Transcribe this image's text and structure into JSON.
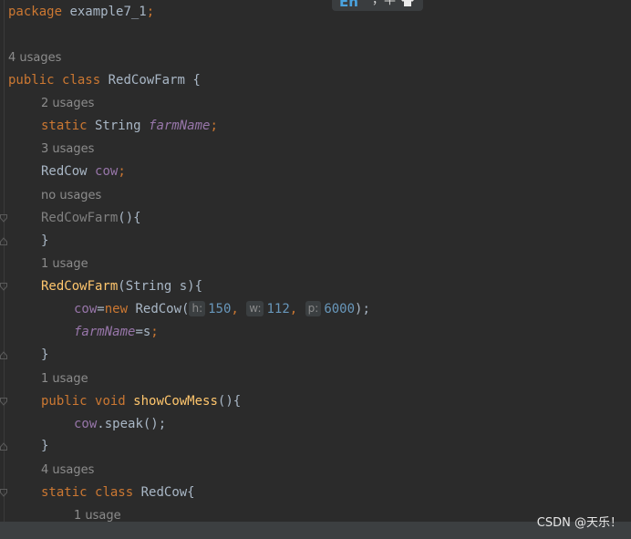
{
  "code_lines": {
    "package_kw": "package",
    "package_name": " example7_1",
    "semicolon": ";",
    "usage_4": "4 usages",
    "class_kw1": "public",
    "class_kw2": "class",
    "class_name": " RedCowFarm {",
    "usage_2": "2 usages",
    "static_kw": "static",
    "string_type": " String ",
    "farm_name": "farmName",
    "usage_3": "3 usages",
    "redcow_type": "RedCow ",
    "cow_field": "cow",
    "no_usages": "no usages",
    "ctor_unused": "RedCowFarm",
    "ctor_unused_rest": "(){",
    "close_brace": "}",
    "usage_1a": "1 usage",
    "ctor_name": "RedCowFarm",
    "ctor_params": "(String s){",
    "assign_cow": "cow",
    "eq_new": "=",
    "new_kw": "new",
    "redcow_call": " RedCow(",
    "hint_h": "h:",
    "val_h": "150",
    "comma": ", ",
    "hint_w": "w:",
    "val_w": "112",
    "hint_p": "p:",
    "val_p": "6000",
    "call_end": ");",
    "farm_name_assign": "=s",
    "usage_1b": "1 usage",
    "public_kw": "public",
    "void_kw": "void",
    "method_name": "showCowMess",
    "method_rest": "(){",
    "cow_call": "cow",
    "speak_call": ".speak();",
    "usage_4b": "4 usages",
    "inner_static": "static",
    "inner_class": "class",
    "inner_name": " RedCow{",
    "usage_1c": "1 usage"
  },
  "ime_indicator": {
    "lang": "En",
    "sep": "，半",
    "shirt_icon": "shirt-icon"
  },
  "watermark": "CSDN @天乐！",
  "colors": {
    "background": "#2b2b2b",
    "keyword": "#cc7832",
    "function": "#ffc66d",
    "field": "#9876aa",
    "number": "#6897bb",
    "text": "#a9b7c6",
    "hint": "#8c8c8c"
  }
}
